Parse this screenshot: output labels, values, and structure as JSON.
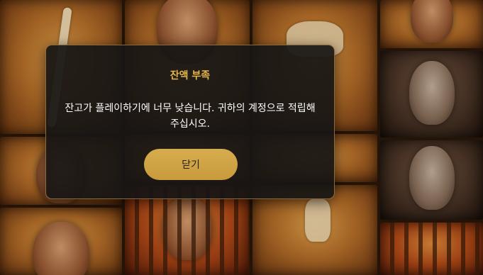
{
  "modal": {
    "title": "잔액 부족",
    "message": "잔고가 플레이하기에 너무 낮습니다. 귀하의 계정으로 적립해 주십시오.",
    "close_label": "닫기"
  },
  "colors": {
    "title_accent": "#e5b648",
    "button_fill": "#d0a444",
    "modal_background": "#181614"
  },
  "background": {
    "description_icons": [
      "bandaged-face-symbol",
      "ribcage-symbol",
      "spine-symbol",
      "woman-face-symbol",
      "masked-prisoner-symbol",
      "foot-bones-symbol"
    ]
  }
}
